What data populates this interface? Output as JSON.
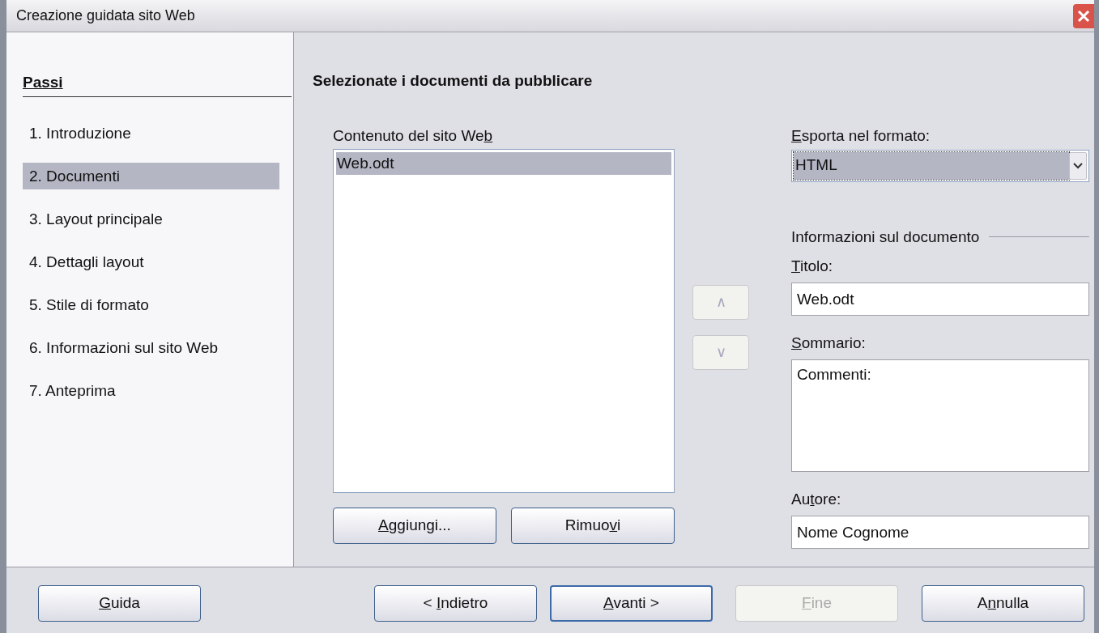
{
  "window": {
    "title": "Creazione guidata sito Web"
  },
  "steps_heading": "Passi",
  "steps": [
    {
      "label": "1. Introduzione",
      "selected": false
    },
    {
      "label": "2. Documenti",
      "selected": true
    },
    {
      "label": "3. Layout principale",
      "selected": false
    },
    {
      "label": "4. Dettagli layout",
      "selected": false
    },
    {
      "label": "5. Stile di formato",
      "selected": false
    },
    {
      "label": "6. Informazioni sul sito Web",
      "selected": false
    },
    {
      "label": "7. Anteprima",
      "selected": false
    }
  ],
  "page_heading": "Selezionate i documenti da pubblicare",
  "content_list": {
    "label": {
      "pre": "Contenuto del sito We",
      "key": "b"
    },
    "items": [
      {
        "label": "Web.odt",
        "selected": true
      }
    ]
  },
  "list_buttons": [
    {
      "key": "A",
      "post": "ggiungi..."
    },
    {
      "pre": "Rimuo",
      "key": "v",
      "post": "i"
    }
  ],
  "move_buttons": [
    {
      "label": "∧",
      "disabled": true
    },
    {
      "label": "∨",
      "disabled": true
    }
  ],
  "export_format": {
    "label": {
      "key": "E",
      "post": "sporta nel formato:"
    },
    "value": "HTML"
  },
  "document_info": {
    "heading": "Informazioni sul documento",
    "fields": [
      {
        "kind": "line",
        "label": {
          "key": "T",
          "post": "itolo:"
        },
        "value": "Web.odt"
      },
      {
        "kind": "area",
        "label": {
          "key": "S",
          "post": "ommario:"
        },
        "value": "Commenti:"
      },
      {
        "kind": "line",
        "label": {
          "pre": "Au",
          "key": "t",
          "post": "ore:"
        },
        "value": "Nome Cognome"
      }
    ]
  },
  "footer_buttons": [
    {
      "label": {
        "key": "G",
        "post": "uida"
      },
      "disabled": false,
      "default": false
    },
    {
      "label": {
        "pre": "< ",
        "key": "I",
        "post": "ndietro"
      },
      "disabled": false,
      "default": false
    },
    {
      "label": {
        "key": "A",
        "post": "vanti >"
      },
      "disabled": false,
      "default": true
    },
    {
      "label": {
        "key": "F",
        "post": "ine"
      },
      "disabled": true,
      "default": false
    },
    {
      "label": {
        "pre": "A",
        "key": "n",
        "post": "nulla"
      },
      "disabled": false,
      "default": false
    }
  ]
}
